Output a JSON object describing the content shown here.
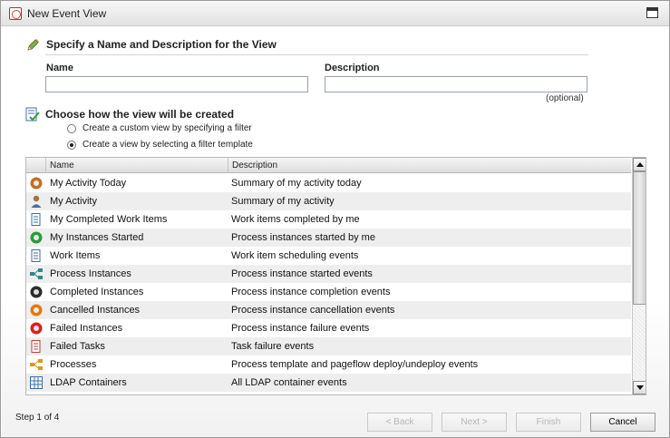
{
  "window": {
    "title": "New Event View"
  },
  "name_section": {
    "heading": "Specify a Name and Description for the View",
    "name_label": "Name",
    "name_value": "",
    "description_label": "Description",
    "description_value": "",
    "optional_hint": "(optional)"
  },
  "create_section": {
    "heading": "Choose how the view will be created",
    "options": [
      {
        "label": "Create a custom view by specifying a filter",
        "selected": false
      },
      {
        "label": "Create a view by selecting a filter template",
        "selected": true
      }
    ]
  },
  "table": {
    "columns": [
      "Name",
      "Description"
    ],
    "rows": [
      {
        "icon": "clock-user-icon",
        "icon_color": "#c0702a",
        "name": "My Activity Today",
        "description": "Summary of my activity today"
      },
      {
        "icon": "user-icon",
        "icon_color": "#a4743e",
        "name": "My Activity",
        "description": "Summary of my activity"
      },
      {
        "icon": "completed-work-items-icon",
        "icon_color": "#3a6ea5",
        "name": "My Completed Work Items",
        "description": "Work items completed by me"
      },
      {
        "icon": "instances-started-icon",
        "icon_color": "#2f9a3c",
        "name": "My Instances Started",
        "description": "Process instances started by me"
      },
      {
        "icon": "work-items-icon",
        "icon_color": "#3a6ea5",
        "name": "Work Items",
        "description": "Work item scheduling events"
      },
      {
        "icon": "process-instances-icon",
        "icon_color": "#2c8a8a",
        "name": "Process Instances",
        "description": "Process instance started events"
      },
      {
        "icon": "checkmark-icon",
        "icon_color": "#2b2b2b",
        "name": "Completed Instances",
        "description": "Process instance completion events"
      },
      {
        "icon": "cancel-icon",
        "icon_color": "#e07a12",
        "name": "Cancelled Instances",
        "description": "Process instance cancellation events"
      },
      {
        "icon": "failed-icon",
        "icon_color": "#d32222",
        "name": "Failed Instances",
        "description": "Process instance failure events"
      },
      {
        "icon": "failed-tasks-icon",
        "icon_color": "#c23a3a",
        "name": "Failed Tasks",
        "description": "Task failure events"
      },
      {
        "icon": "processes-icon",
        "icon_color": "#d79a1c",
        "name": "Processes",
        "description": "Process template and pageflow deploy/undeploy events"
      },
      {
        "icon": "ldap-containers-icon",
        "icon_color": "#3a6ea5",
        "name": "LDAP Containers",
        "description": "All LDAP container events"
      }
    ]
  },
  "footer": {
    "step": "Step 1 of 4",
    "back_label": "< Back",
    "next_label": "Next >",
    "finish_label": "Finish",
    "cancel_label": "Cancel"
  }
}
